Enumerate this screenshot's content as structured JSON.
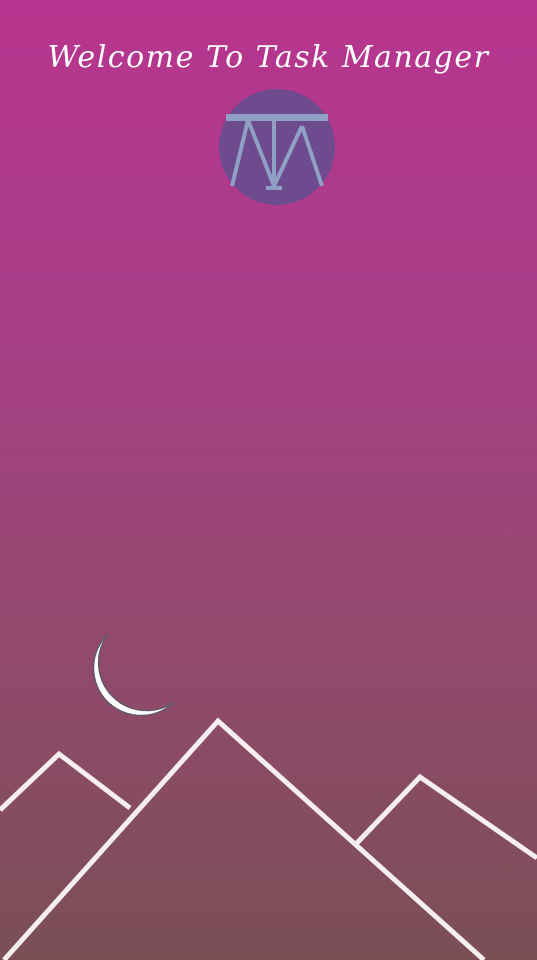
{
  "app": {
    "title": "Welcome To Task Manager"
  },
  "logo": {
    "icon": "tm-monogram-icon",
    "circle_color": "#6e4a8e",
    "stroke_color": "#8fa0c4"
  },
  "scene": {
    "moon_icon": "crescent-moon-icon",
    "mountain_icon": "mountain-outline-icon",
    "line_color": "#f6eef0",
    "gradient_top": "#b8358f",
    "gradient_bottom": "#7a4f56"
  }
}
